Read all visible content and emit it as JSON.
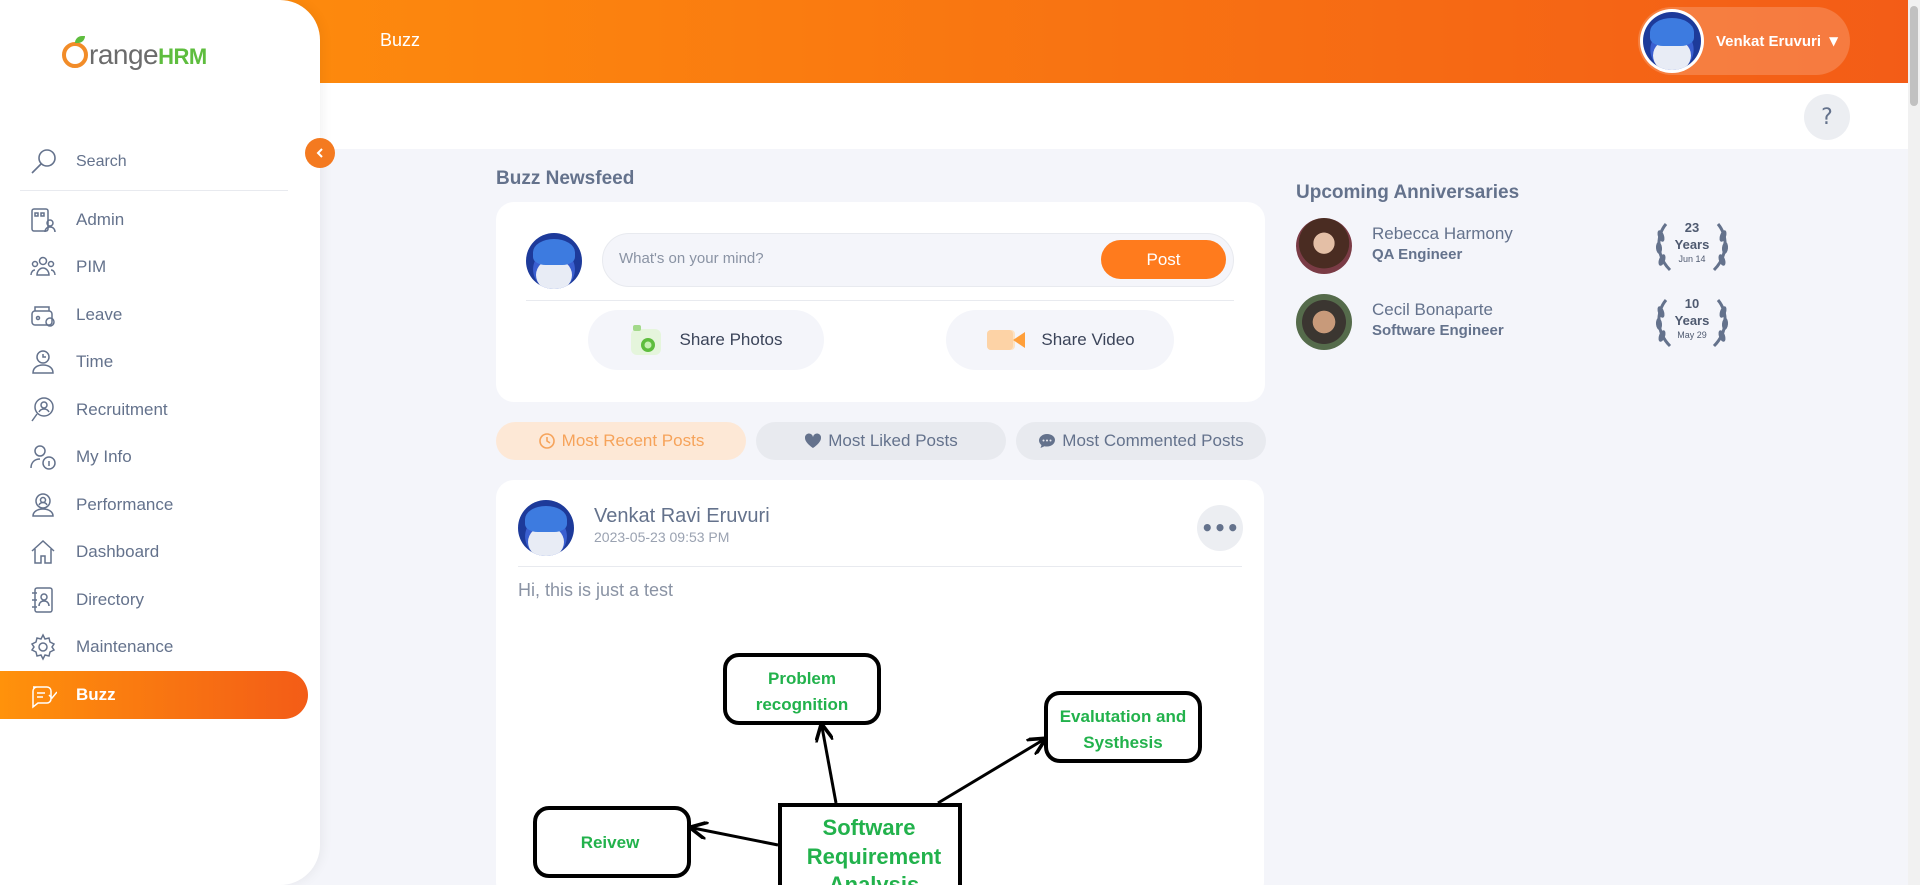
{
  "topbar": {
    "title": "Buzz",
    "user_name": "Venkat Eruvuri"
  },
  "brand": {
    "name_main": "range",
    "name_accent": "HRM"
  },
  "sidebar": {
    "search_placeholder": "Search",
    "items": [
      {
        "label": "Admin"
      },
      {
        "label": "PIM"
      },
      {
        "label": "Leave"
      },
      {
        "label": "Time"
      },
      {
        "label": "Recruitment"
      },
      {
        "label": "My Info"
      },
      {
        "label": "Performance"
      },
      {
        "label": "Dashboard"
      },
      {
        "label": "Directory"
      },
      {
        "label": "Maintenance"
      },
      {
        "label": "Buzz"
      }
    ]
  },
  "help": {
    "label": "?"
  },
  "newsfeed": {
    "title": "Buzz Newsfeed",
    "composer_placeholder": "What's on your mind?",
    "post_button": "Post",
    "share_photos": "Share Photos",
    "share_video": "Share Video",
    "tabs": [
      {
        "label": "Most Recent Posts"
      },
      {
        "label": "Most Liked Posts"
      },
      {
        "label": "Most Commented Posts"
      }
    ]
  },
  "post": {
    "author": "Venkat Ravi Eruvuri",
    "timestamp": "2023-05-23 09:53 PM",
    "text": "Hi, this is just a test",
    "more": "•••",
    "diagram": {
      "center": "Software Requirement Analysis",
      "nodes": [
        "Problem recognition",
        "Evalutation and Systhesis",
        "Reivew"
      ]
    }
  },
  "anniversaries": {
    "title": "Upcoming Anniversaries",
    "items": [
      {
        "name": "Rebecca Harmony",
        "role": "QA Engineer",
        "years": "23",
        "years_label": "Years",
        "date": "Jun 14"
      },
      {
        "name": "Cecil Bonaparte",
        "role": "Software Engineer",
        "years": "10",
        "years_label": "Years",
        "date": "May 29"
      }
    ]
  },
  "colors": {
    "brand_orange": "#ff7b1d",
    "brand_green": "#5ebd3e",
    "text_primary": "#64728c"
  }
}
